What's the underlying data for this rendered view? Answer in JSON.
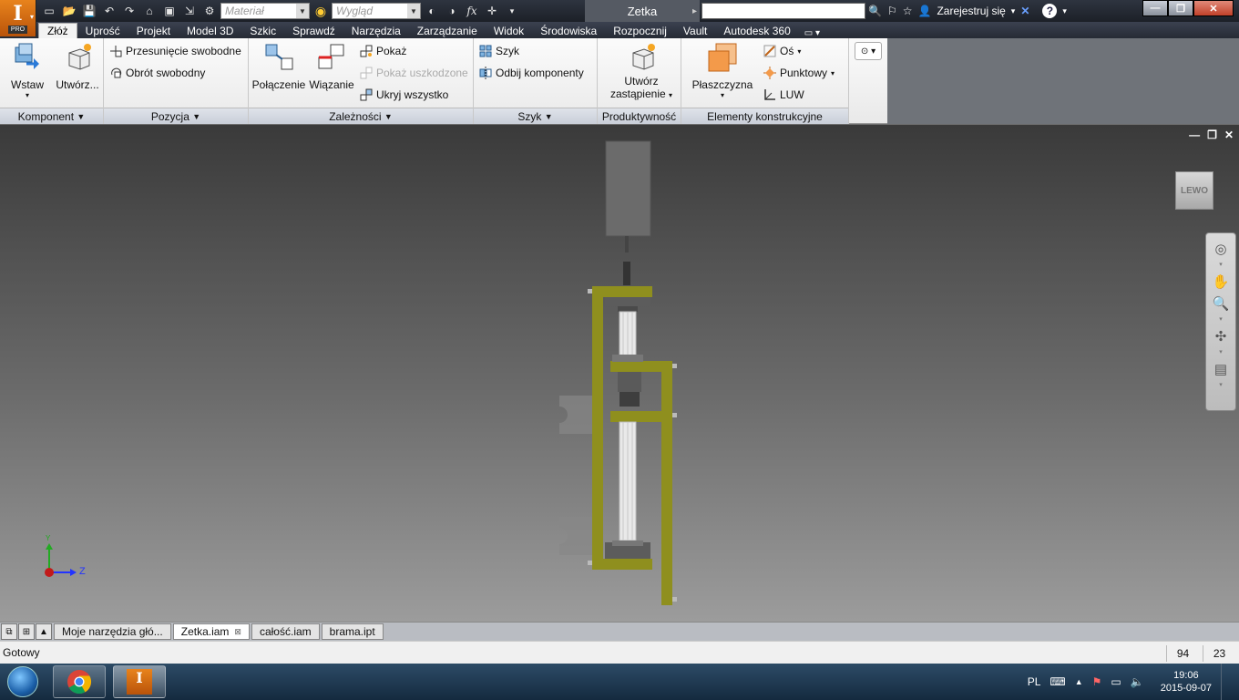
{
  "app": {
    "logo_text": "I",
    "logo_badge": "PRO",
    "document_title": "Zetka"
  },
  "qat": {
    "material_placeholder": "Materiał",
    "appearance_placeholder": "Wygląd",
    "fx_label": "fx"
  },
  "title_right": {
    "signin_label": "Zarejestruj się",
    "help_label": "?"
  },
  "tabs": [
    {
      "label": "Złóż",
      "active": true
    },
    {
      "label": "Uprość"
    },
    {
      "label": "Projekt"
    },
    {
      "label": "Model 3D"
    },
    {
      "label": "Szkic"
    },
    {
      "label": "Sprawdź"
    },
    {
      "label": "Narzędzia"
    },
    {
      "label": "Zarządzanie"
    },
    {
      "label": "Widok"
    },
    {
      "label": "Środowiska"
    },
    {
      "label": "Rozpocznij"
    },
    {
      "label": "Vault"
    },
    {
      "label": "Autodesk 360"
    }
  ],
  "ribbon": {
    "komponent": {
      "title": "Komponent",
      "insert": "Wstaw",
      "create": "Utwórz..."
    },
    "pozycja": {
      "title": "Pozycja",
      "free_move": "Przesunięcie swobodne",
      "free_rotate": "Obrót swobodny"
    },
    "zaleznosci": {
      "title": "Zależności",
      "joint": "Połączenie",
      "constrain": "Wiązanie",
      "show": "Pokaż",
      "show_sick": "Pokaż uszkodzone",
      "hide_all": "Ukryj wszystko"
    },
    "szyk": {
      "title": "Szyk",
      "pattern": "Szyk",
      "mirror": "Odbij komponenty"
    },
    "produktywnosc": {
      "title": "Produktywność",
      "substitute_line1": "Utwórz",
      "substitute_line2": "zastąpienie"
    },
    "elementy": {
      "title": "Elementy konstrukcyjne",
      "plane": "Płaszczyzna",
      "axis": "Oś",
      "point": "Punktowy",
      "ucs": "LUW"
    }
  },
  "viewport": {
    "viewcube_label": "LEWO",
    "axis_z_label": "Z",
    "axis_y_label": "Y"
  },
  "doc_tabs": [
    {
      "label": "Moje narzędzia głó..."
    },
    {
      "label": "Zetka.iam",
      "active": true
    },
    {
      "label": "całość.iam"
    },
    {
      "label": "brama.ipt"
    }
  ],
  "status": {
    "text": "Gotowy",
    "count1": "94",
    "count2": "23"
  },
  "taskbar": {
    "lang": "PL",
    "time": "19:06",
    "date": "2015-09-07"
  },
  "colors": {
    "frame_yellow": "#8f8f1e",
    "ribbon_bg": "#f3f3f3",
    "titlebar": "#262b35"
  }
}
